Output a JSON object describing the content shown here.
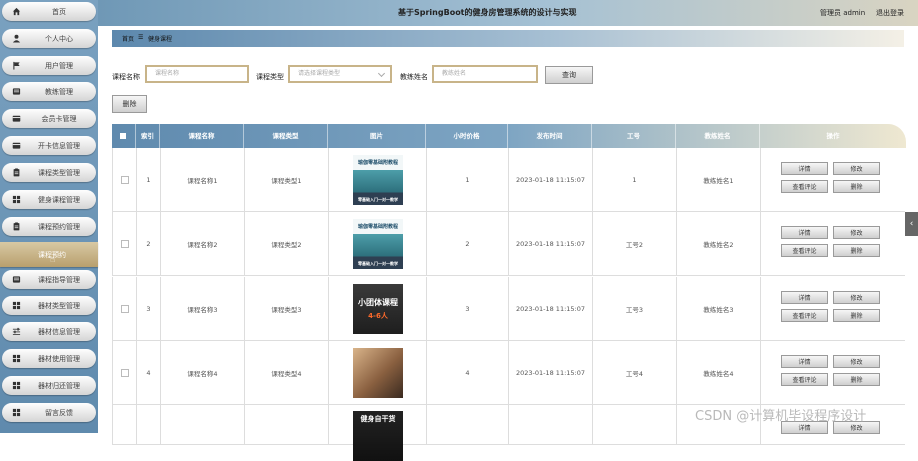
{
  "header": {
    "title": "基于SpringBoot的健身房管理系统的设计与实现",
    "admin": "管理员 admin",
    "logout": "退出登录"
  },
  "sidebar": {
    "items": [
      {
        "label": "首页",
        "icon": "home-icon"
      },
      {
        "label": "个人中心",
        "icon": "user-icon"
      },
      {
        "label": "用户管理",
        "icon": "flag-icon"
      },
      {
        "label": "教练管理",
        "icon": "list-icon"
      },
      {
        "label": "会员卡管理",
        "icon": "card-icon"
      },
      {
        "label": "开卡信息管理",
        "icon": "card-icon"
      },
      {
        "label": "课程类型管理",
        "icon": "clipboard-icon"
      },
      {
        "label": "健身课程管理",
        "icon": "grid-icon"
      },
      {
        "label": "课程预约管理",
        "icon": "clipboard-icon"
      },
      {
        "label": "课程预约",
        "icon": ""
      },
      {
        "label": "课程指导管理",
        "icon": "list-icon"
      },
      {
        "label": "器材类型管理",
        "icon": "grid-icon"
      },
      {
        "label": "器材信息管理",
        "icon": "sliders-icon"
      },
      {
        "label": "器材使用管理",
        "icon": "grid-icon"
      },
      {
        "label": "器材归还管理",
        "icon": "grid-icon"
      },
      {
        "label": "留言反馈",
        "icon": "grid-icon"
      }
    ],
    "active_index": 9
  },
  "breadcrumb": {
    "home": "首页",
    "sep": "☰",
    "current": "健身课程"
  },
  "search": {
    "course_name_label": "课程名称",
    "course_name_placeholder": "课程名称",
    "course_type_label": "课程类型",
    "course_type_placeholder": "请选择课程类型",
    "coach_name_label": "教练姓名",
    "coach_name_placeholder": "教练姓名",
    "search_btn": "查询",
    "delete_btn": "删除"
  },
  "table": {
    "headers": [
      "索引",
      "课程名称",
      "课程类型",
      "图片",
      "小时价格",
      "发布时间",
      "工号",
      "教练姓名",
      "操作"
    ],
    "actions": {
      "detail": "详情",
      "edit": "修改",
      "comments": "查看评论",
      "delete": "删除"
    },
    "rows": [
      {
        "index": "1",
        "name": "课程名称1",
        "type": "课程类型1",
        "price": "1",
        "time": "2023-01-18 11:15:07",
        "job_no": "1",
        "coach": "教练姓名1",
        "pic": "cyan",
        "pic_top": "瑜伽零基础附教程",
        "pic_bot": "零基础入门一对一教学"
      },
      {
        "index": "2",
        "name": "课程名称2",
        "type": "课程类型2",
        "price": "2",
        "time": "2023-01-18 11:15:07",
        "job_no": "工号2",
        "coach": "教练姓名2",
        "pic": "cyan",
        "pic_top": "瑜伽零基础附教程",
        "pic_bot": "零基础入门一对一教学"
      },
      {
        "index": "3",
        "name": "课程名称3",
        "type": "课程类型3",
        "price": "3",
        "time": "2023-01-18 11:15:07",
        "job_no": "工号3",
        "coach": "教练姓名3",
        "pic": "dark",
        "pic_top": "小团体课程",
        "pic_bot": "4-6人"
      },
      {
        "index": "4",
        "name": "课程名称4",
        "type": "课程类型4",
        "price": "4",
        "time": "2023-01-18 11:15:07",
        "job_no": "工号4",
        "coach": "教练姓名4",
        "pic": "warm",
        "pic_top": "",
        "pic_bot": ""
      },
      {
        "index": "",
        "name": "",
        "type": "",
        "price": "",
        "time": "",
        "job_no": "",
        "coach": "",
        "pic": "black",
        "pic_top": "健身自干货",
        "pic_bot": ""
      }
    ]
  },
  "watermark": "CSDN @计算机毕设程序设计",
  "colors": {
    "accent": "#6f98b6",
    "gold": "#c8b489"
  }
}
